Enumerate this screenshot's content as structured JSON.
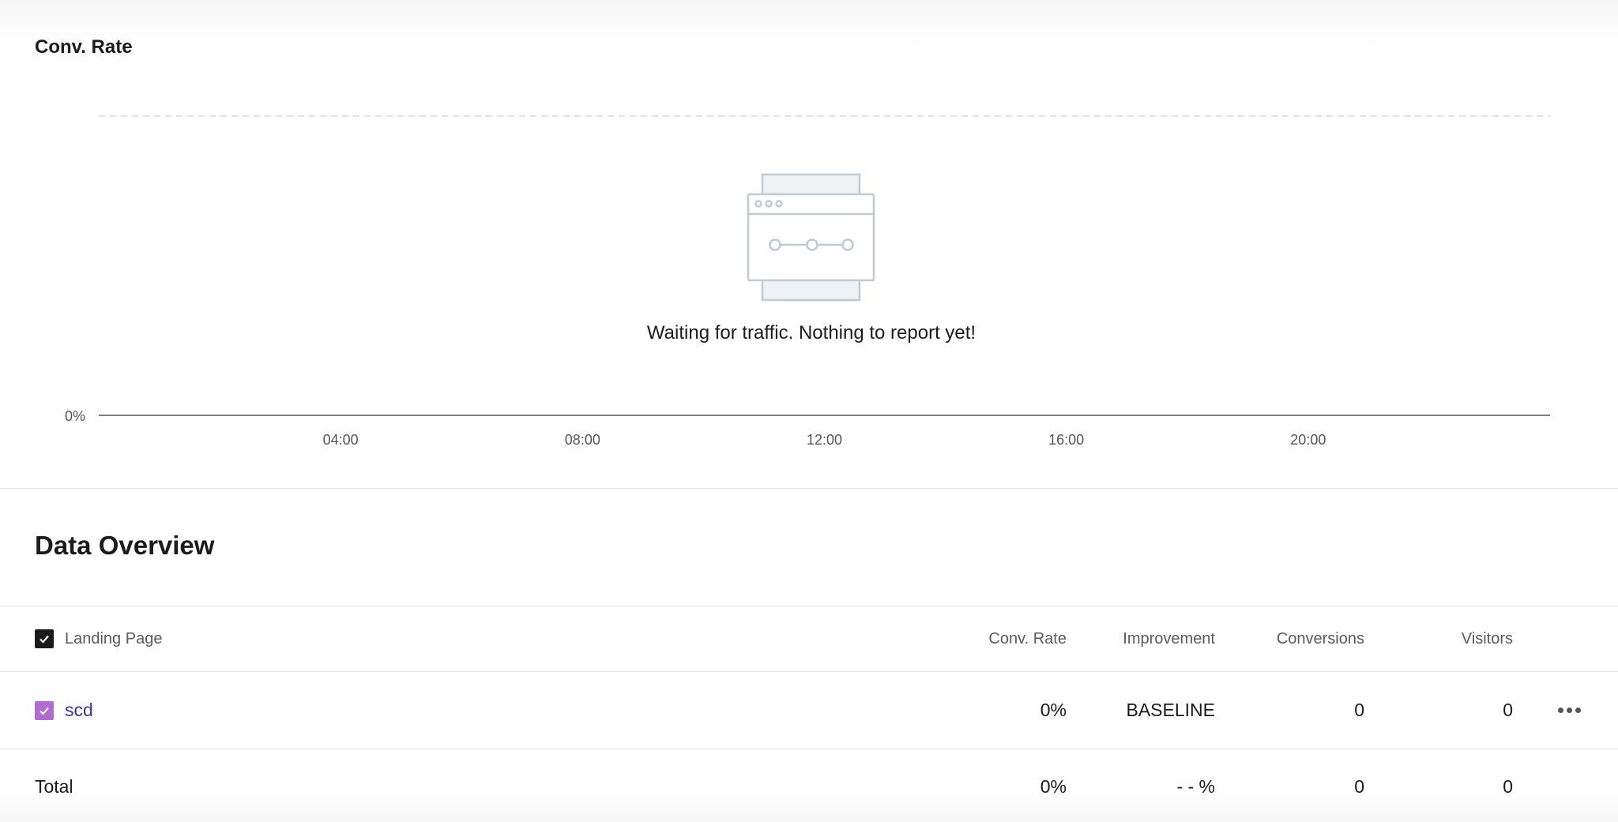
{
  "chart_data": {
    "type": "line",
    "title": "Conv. Rate",
    "y_tick_labels": [
      "0%"
    ],
    "x_tick_labels": [
      "04:00",
      "08:00",
      "12:00",
      "16:00",
      "20:00"
    ],
    "series": [],
    "grid": true
  },
  "empty_state": {
    "message": "Waiting for traffic. Nothing to report yet!",
    "icon": "browser-timeline-illustration-icon"
  },
  "overview": {
    "title": "Data Overview",
    "columns": {
      "name": "Landing Page",
      "conv_rate": "Conv. Rate",
      "improvement": "Improvement",
      "conversions": "Conversions",
      "visitors": "Visitors"
    },
    "rows": [
      {
        "name": "scd",
        "conv_rate": "0%",
        "improvement": "BASELINE",
        "conversions": "0",
        "visitors": "0",
        "checkbox_color": "#b06ccf"
      }
    ],
    "total": {
      "label": "Total",
      "conv_rate": "0%",
      "improvement": "- - %",
      "conversions": "0",
      "visitors": "0"
    }
  },
  "colors": {
    "header_checkbox": "#1b1b1b",
    "link": "#2f3a8f"
  }
}
